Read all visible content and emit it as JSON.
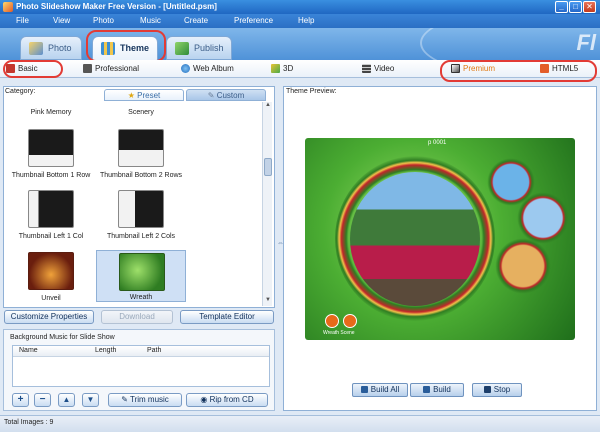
{
  "window": {
    "title": "Photo Slideshow Maker Free Version - [Untitled.psm]",
    "min_label": "_",
    "max_label": "□",
    "close_label": "✕"
  },
  "menu": [
    "File",
    "View",
    "Photo",
    "Music",
    "Create",
    "Preference",
    "Help"
  ],
  "banner_text": "Fl",
  "main_tabs": [
    {
      "label": "Photo",
      "icon": "photo-icon"
    },
    {
      "label": "Theme",
      "icon": "theme-icon",
      "active": true
    },
    {
      "label": "Publish",
      "icon": "publish-icon"
    }
  ],
  "sub_tabs": [
    {
      "label": "Basic",
      "icon": "basic-icon",
      "active": true
    },
    {
      "label": "Professional",
      "icon": "camera-icon"
    },
    {
      "label": "Web Album",
      "icon": "globe-icon"
    },
    {
      "label": "3D",
      "icon": "3d-icon"
    },
    {
      "label": "Video",
      "icon": "film-icon"
    },
    {
      "label": "Premium",
      "icon": "premium-icon",
      "highlight": true
    },
    {
      "label": "HTML5",
      "icon": "html5-icon"
    }
  ],
  "category_label": "Category:",
  "preset_tabs": {
    "preset": "Preset",
    "custom": "Custom"
  },
  "themes": [
    {
      "name": "Pink Memory"
    },
    {
      "name": "Scenery"
    },
    {
      "name": "Thumbnail Bottom 1 Row"
    },
    {
      "name": "Thumbnail Bottom 2 Rows"
    },
    {
      "name": "Thumbnail Left 1 Col"
    },
    {
      "name": "Thumbnail Left 2 Cols"
    },
    {
      "name": "Unveil"
    },
    {
      "name": "Wreath",
      "selected": true
    }
  ],
  "left_buttons": {
    "customize": "Customize Properties",
    "download": "Download",
    "template_editor": "Template Editor"
  },
  "music": {
    "legend": "Background Music for Slide Show",
    "columns": [
      "Name",
      "Length",
      "Path"
    ],
    "trim": "Trim music",
    "rip": "Rip from CD",
    "icon_buttons": [
      "+",
      "−",
      "▲",
      "▼"
    ]
  },
  "preview": {
    "label": "Theme Preview:",
    "page_num": "p 0001",
    "caption": "Wreath Scene"
  },
  "build": {
    "build_all": "Build All",
    "build": "Build",
    "stop": "Stop"
  },
  "status": {
    "total_images": "Total Images : 9"
  },
  "colors": {
    "accent": "#2a6fc4",
    "highlight_oval": "#e23b35",
    "premium_orange": "#e07a16"
  }
}
